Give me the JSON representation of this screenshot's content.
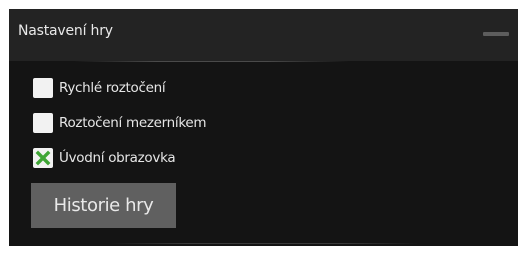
{
  "panel": {
    "title": "Nastavení hry",
    "minimize_icon": "minimize-icon"
  },
  "options": [
    {
      "label": "Rychlé roztočení",
      "checked": false
    },
    {
      "label": "Roztočení mezerníkem",
      "checked": false
    },
    {
      "label": "Úvodní obrazovka",
      "checked": true
    }
  ],
  "history_button": {
    "label": "Historie hry"
  },
  "colors": {
    "panel_background": "#141414",
    "header_background": "#232323",
    "checkbox_background": "#f2f2f2",
    "check_mark": "#3fa535",
    "button_background": "#606060",
    "text": "#e6e6e6"
  }
}
